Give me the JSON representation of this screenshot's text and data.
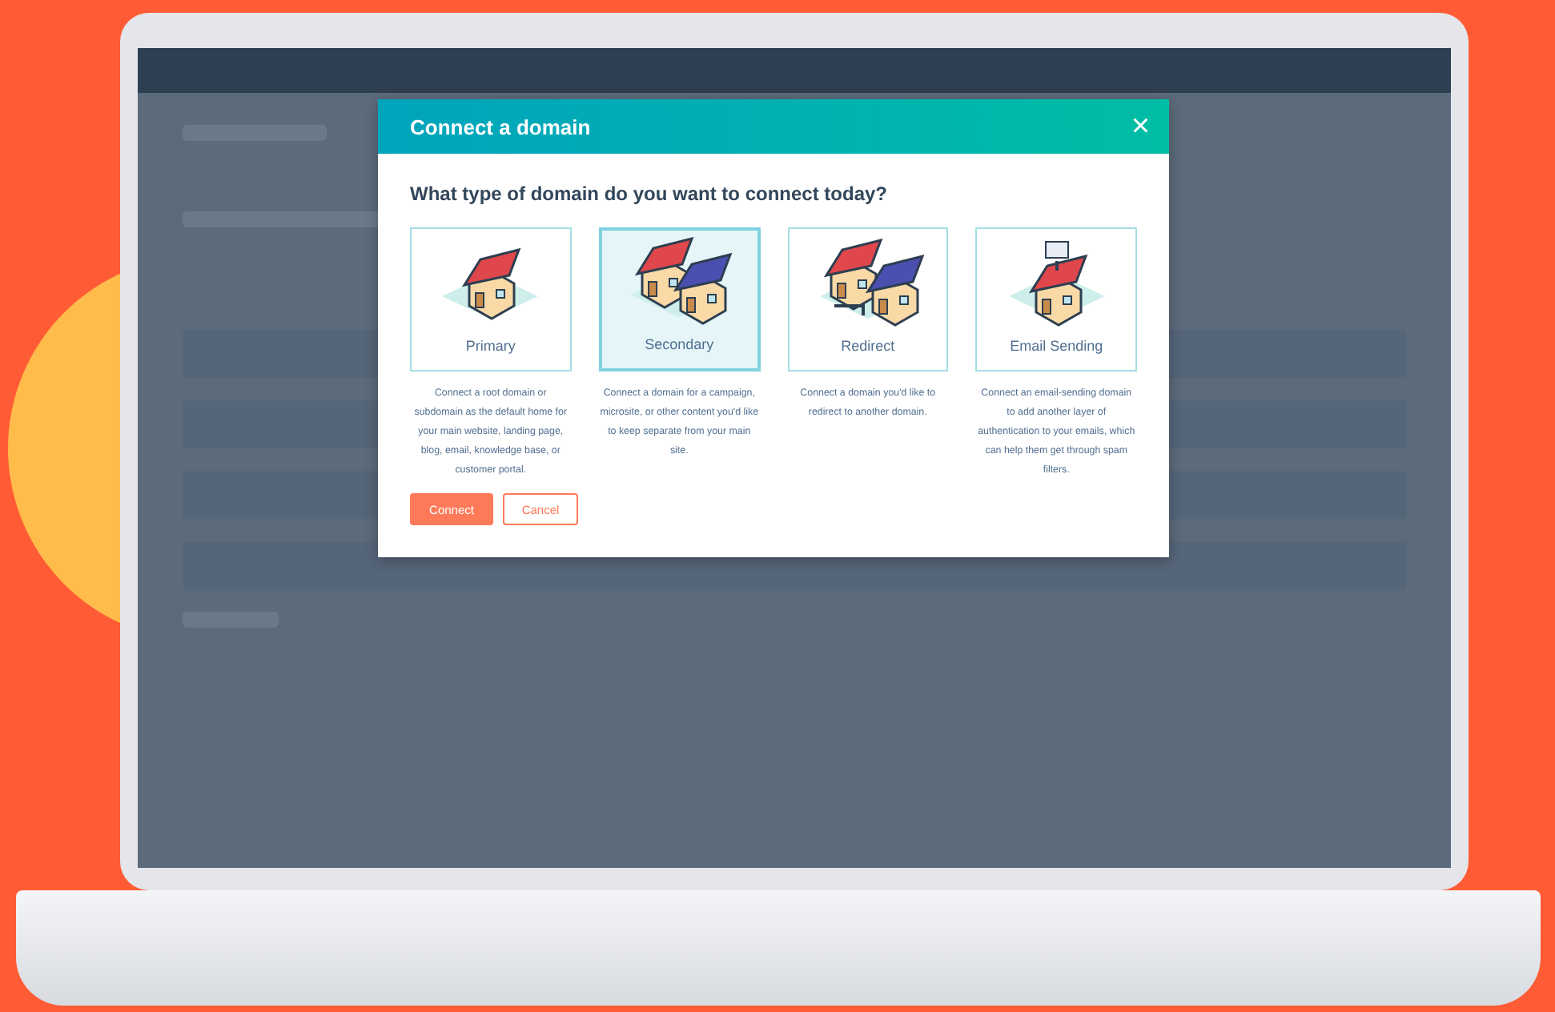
{
  "dialog": {
    "title": "Connect a domain",
    "close_icon": "×",
    "question": "What type of domain do you want to connect today?",
    "options": [
      {
        "label": "Primary",
        "selected": false,
        "kind": "single",
        "description": "Connect a root domain or subdomain as the default home for your main website, landing page, blog, email, knowledge base, or customer portal."
      },
      {
        "label": "Secondary",
        "selected": true,
        "kind": "pair",
        "description": "Connect a domain for a campaign, microsite, or other content you'd like to keep separate from your main site."
      },
      {
        "label": "Redirect",
        "selected": false,
        "kind": "redirect",
        "description": "Connect a domain you'd like to redirect to another domain."
      },
      {
        "label": "Email Sending",
        "selected": false,
        "kind": "email",
        "description": "Connect an email-sending domain to add another layer of authentication to your emails, which can help them get through spam filters."
      }
    ],
    "buttons": [
      {
        "label": "Connect",
        "kind": "primary"
      },
      {
        "label": "Cancel",
        "kind": "secondary"
      }
    ]
  }
}
